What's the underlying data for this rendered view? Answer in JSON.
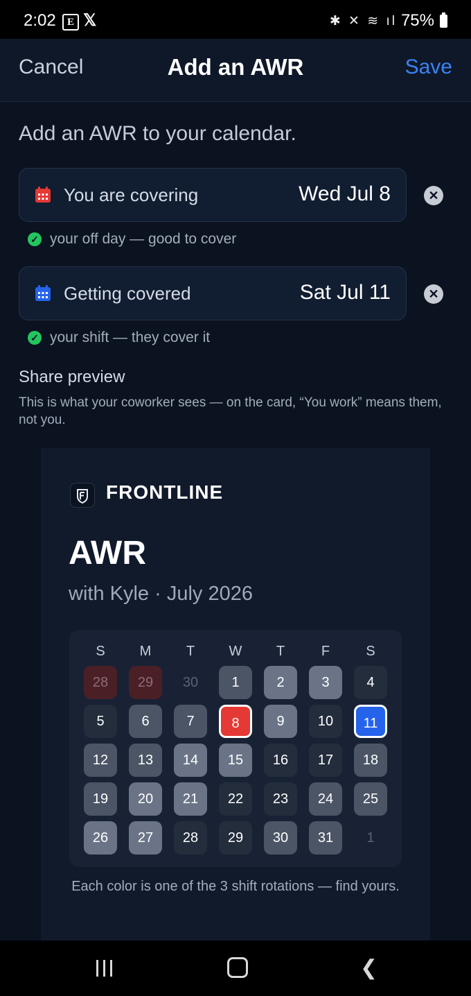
{
  "status_bar": {
    "time": "2:02",
    "battery": "75%"
  },
  "header": {
    "cancel": "Cancel",
    "title": "Add an AWR",
    "save": "Save"
  },
  "intro": "Add an AWR to your calendar.",
  "covering": {
    "label": "You are covering",
    "value": "Wed Jul 8",
    "hint": "your off day — good to cover",
    "icon_color": "#e53935"
  },
  "covered": {
    "label": "Getting covered",
    "value": "Sat Jul 11",
    "hint": "your shift — they cover it",
    "icon_color": "#2563eb"
  },
  "share": {
    "title": "Share preview",
    "description": "This is what your coworker sees — on the card, “You work” means them, not you."
  },
  "card": {
    "brand": "FRONTLINE",
    "title": "AWR",
    "subtitle": "with Kyle · July 2026",
    "weekdays": [
      "S",
      "M",
      "T",
      "W",
      "T",
      "F",
      "S"
    ],
    "weeks": [
      [
        {
          "d": "28",
          "c": "red-dim"
        },
        {
          "d": "29",
          "c": "red-dim"
        },
        {
          "d": "30",
          "c": "none"
        },
        {
          "d": "1",
          "c": "mid"
        },
        {
          "d": "2",
          "c": "light"
        },
        {
          "d": "3",
          "c": "light"
        },
        {
          "d": "4",
          "c": "dark"
        }
      ],
      [
        {
          "d": "5",
          "c": "dark"
        },
        {
          "d": "6",
          "c": "mid"
        },
        {
          "d": "7",
          "c": "mid"
        },
        {
          "d": "8",
          "c": "red"
        },
        {
          "d": "9",
          "c": "light"
        },
        {
          "d": "10",
          "c": "dark"
        },
        {
          "d": "11",
          "c": "blue"
        }
      ],
      [
        {
          "d": "12",
          "c": "mid"
        },
        {
          "d": "13",
          "c": "mid"
        },
        {
          "d": "14",
          "c": "light"
        },
        {
          "d": "15",
          "c": "light"
        },
        {
          "d": "16",
          "c": "dark"
        },
        {
          "d": "17",
          "c": "dark"
        },
        {
          "d": "18",
          "c": "mid"
        }
      ],
      [
        {
          "d": "19",
          "c": "mid"
        },
        {
          "d": "20",
          "c": "light"
        },
        {
          "d": "21",
          "c": "light"
        },
        {
          "d": "22",
          "c": "dark"
        },
        {
          "d": "23",
          "c": "dark"
        },
        {
          "d": "24",
          "c": "mid"
        },
        {
          "d": "25",
          "c": "mid"
        }
      ],
      [
        {
          "d": "26",
          "c": "light"
        },
        {
          "d": "27",
          "c": "light"
        },
        {
          "d": "28",
          "c": "dark"
        },
        {
          "d": "29",
          "c": "dark"
        },
        {
          "d": "30",
          "c": "mid"
        },
        {
          "d": "31",
          "c": "mid"
        },
        {
          "d": "1",
          "c": "none"
        }
      ]
    ],
    "legend": "Each color is one of the 3 shift rotations — find yours."
  },
  "icons": {
    "calendar": "calendar-icon",
    "clear": "close-circle-icon",
    "check": "check-circle-icon",
    "logo": "frontline-logo-icon"
  }
}
